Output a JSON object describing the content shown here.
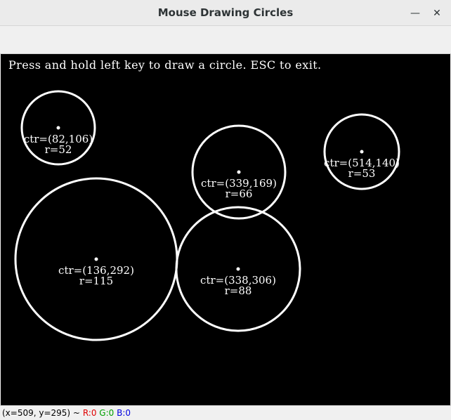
{
  "window": {
    "title": "Mouse Drawing Circles",
    "minimize_icon": "minimize-icon",
    "close_icon": "close-icon"
  },
  "canvas": {
    "background": "#000000",
    "foreground": "#ffffff",
    "instructions": "Press and hold left key to draw a circle. ESC to exit.",
    "circles": [
      {
        "center_label": "ctr=(82,106)",
        "radius_label": "r=52"
      },
      {
        "center_label": "ctr=(339,169)",
        "radius_label": "r=66"
      },
      {
        "center_label": "ctr=(514,140)",
        "radius_label": "r=53"
      },
      {
        "center_label": "ctr=(136,292)",
        "radius_label": "r=115"
      },
      {
        "center_label": "ctr=(338,306)",
        "radius_label": "r=88"
      }
    ]
  },
  "status": {
    "coords": "(x=509, y=295) ~",
    "r": "R:0",
    "g": "G:0",
    "b": "B:0"
  }
}
